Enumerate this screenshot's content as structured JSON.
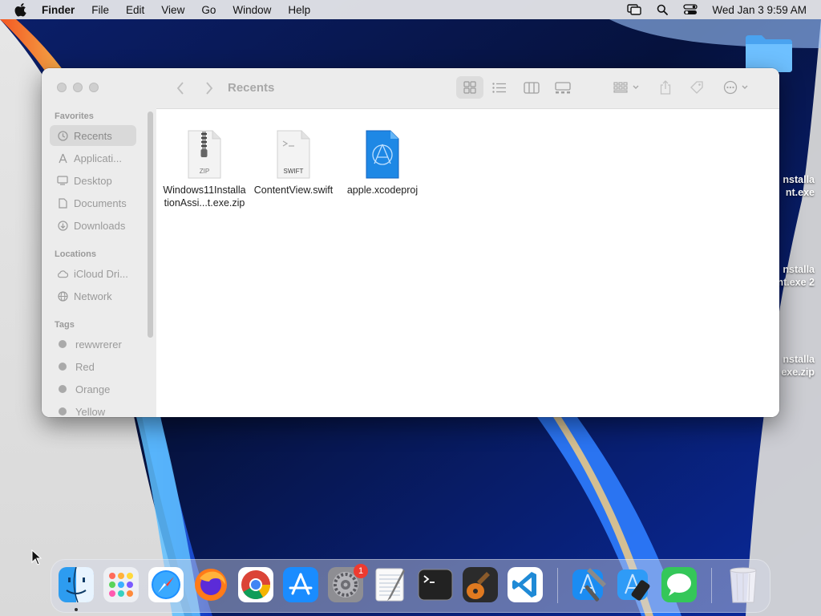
{
  "menubar": {
    "app_name": "Finder",
    "items": [
      "File",
      "Edit",
      "View",
      "Go",
      "Window",
      "Help"
    ],
    "clock": "Wed Jan 3  9:59 AM",
    "icons": [
      "screen-mirroring-icon",
      "spotlight-search-icon",
      "control-center-icon"
    ]
  },
  "desktop": {
    "files": [
      {
        "label_line1": "nstalla",
        "label_line2": "nt.exe"
      },
      {
        "label_line1": "nstalla",
        "label_line2": "nt.exe 2"
      },
      {
        "label_line1": "nstalla",
        "label_line2": "exe.zip"
      }
    ]
  },
  "finder": {
    "title": "Recents",
    "sidebar": {
      "favorites_heading": "Favorites",
      "favorites": [
        {
          "label": "Recents",
          "icon": "clock-icon",
          "selected": true
        },
        {
          "label": "Applicati...",
          "icon": "applications-icon"
        },
        {
          "label": "Desktop",
          "icon": "desktop-icon"
        },
        {
          "label": "Documents",
          "icon": "document-icon"
        },
        {
          "label": "Downloads",
          "icon": "downloads-icon"
        }
      ],
      "locations_heading": "Locations",
      "locations": [
        {
          "label": "iCloud Dri...",
          "icon": "cloud-icon"
        },
        {
          "label": "Network",
          "icon": "network-icon"
        }
      ],
      "tags_heading": "Tags",
      "tags": [
        {
          "label": "rewwrerer"
        },
        {
          "label": "Red"
        },
        {
          "label": "Orange"
        },
        {
          "label": "Yellow"
        }
      ]
    },
    "files": [
      {
        "name": "Windows11InstallationAssi...t.exe.zip",
        "line1": "Windows11Installa",
        "line2": "tionAssi...t.exe.zip",
        "badge": "ZIP"
      },
      {
        "name": "ContentView.swift",
        "line1": "ContentView.swift",
        "line2": "",
        "badge": "SWIFT"
      },
      {
        "name": "apple.xcodeproj",
        "line1": "apple.xcodeproj",
        "line2": "",
        "badge": ""
      }
    ]
  },
  "dock": {
    "apps": [
      "Finder",
      "Launchpad",
      "Safari",
      "Firefox",
      "Chrome",
      "App Store",
      "System Settings",
      "TextEdit",
      "Terminal",
      "GarageBand",
      "Visual Studio Code",
      "Xcode",
      "Simulator",
      "Messages",
      "Trash"
    ],
    "settings_badge": "1"
  },
  "colors": {
    "menubar_bg": "#ececee",
    "sidebar_bg": "#ececec",
    "xcodeproj_blue": "#1e88e5"
  }
}
